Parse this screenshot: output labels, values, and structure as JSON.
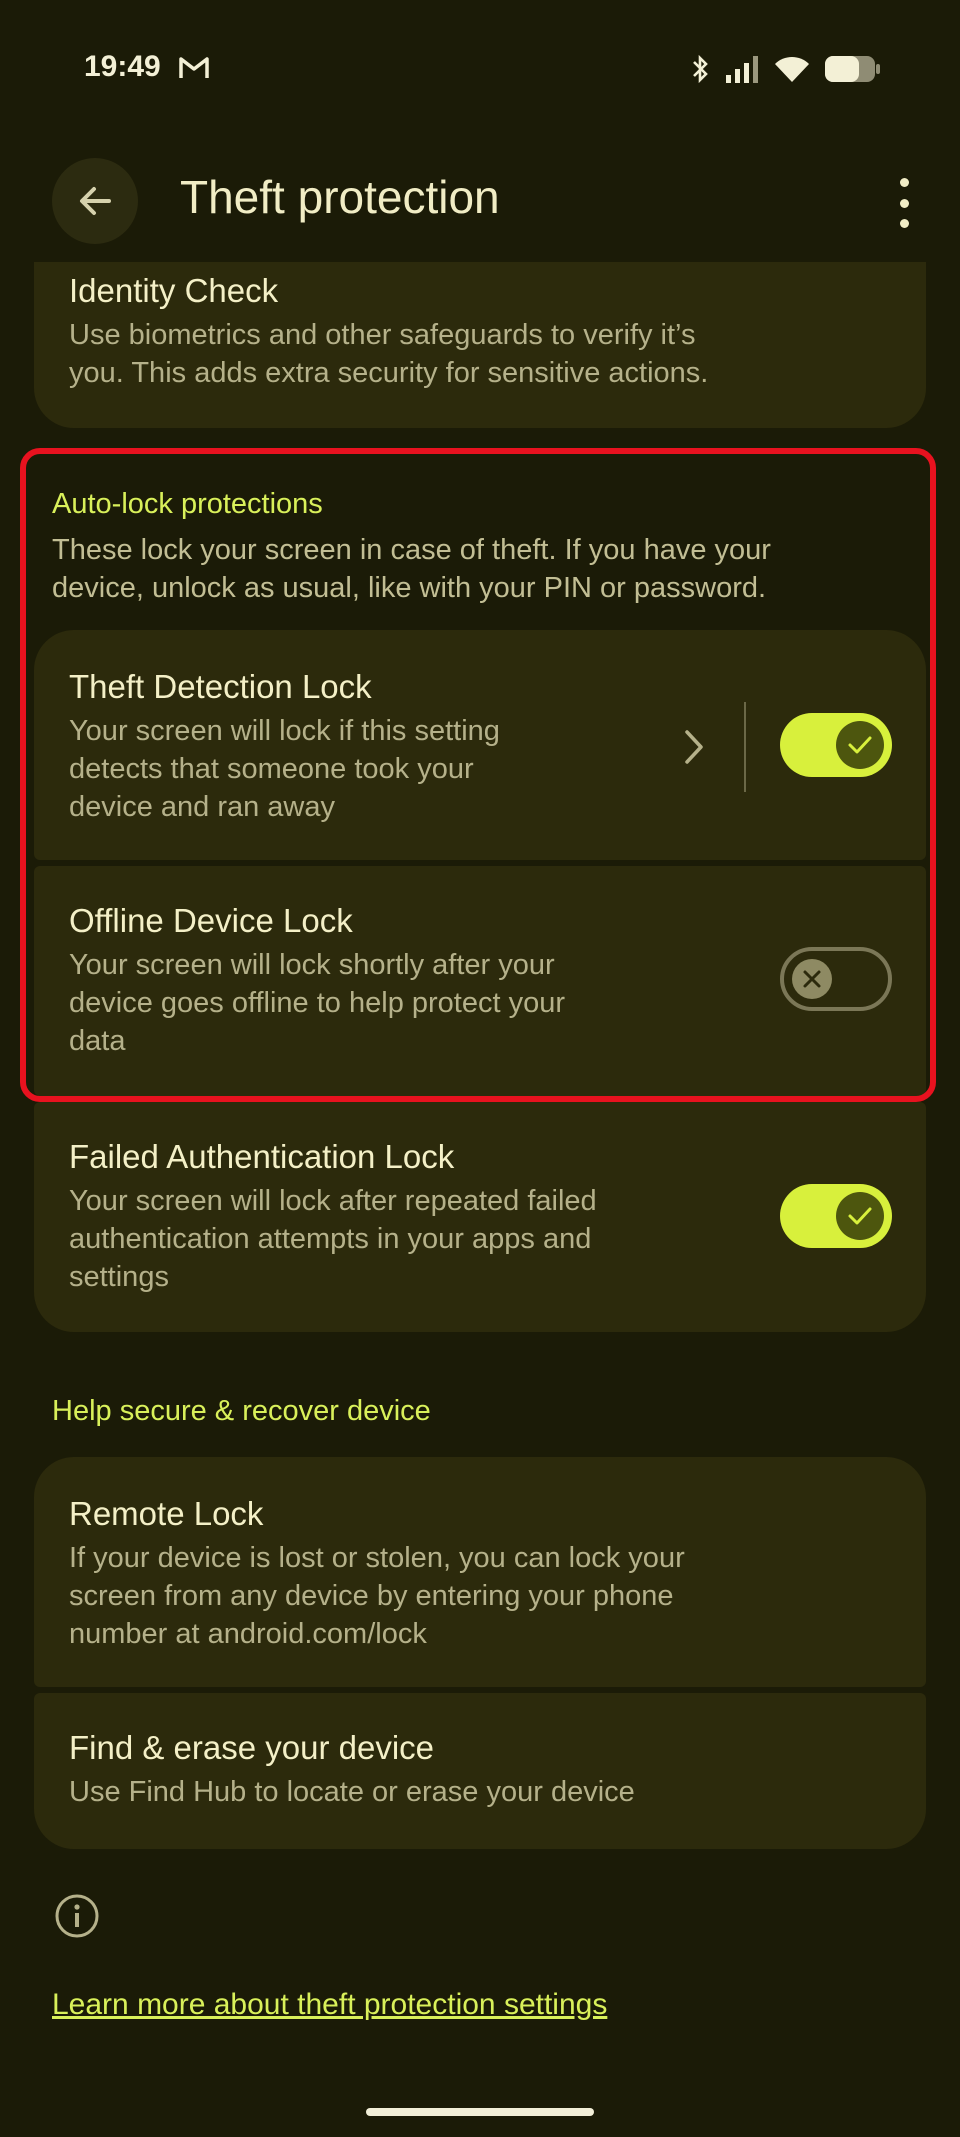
{
  "status_bar": {
    "time": "19:49"
  },
  "app_bar": {
    "title": "Theft protection"
  },
  "identity_check": {
    "title": "Identity Check",
    "desc_line1": "Use biometrics and other safeguards to verify it’s",
    "desc_line2": "you. This adds extra security for sensitive actions."
  },
  "auto_lock": {
    "section_title": "Auto-lock protections",
    "desc_line1": "These lock your screen in case of theft. If you have your",
    "desc_line2": "device, unlock as usual, like with your PIN or password.",
    "items": [
      {
        "title": "Theft Detection Lock",
        "lines": [
          "Your screen will lock if this setting",
          "detects that someone took your",
          "device and ran away"
        ],
        "enabled": true
      },
      {
        "title": "Offline Device Lock",
        "lines": [
          "Your screen will lock shortly after your",
          "device goes offline to help protect your",
          "data"
        ],
        "enabled": false
      },
      {
        "title": "Failed Authentication Lock",
        "lines": [
          "Your screen will lock after repeated failed",
          "authentication attempts in your apps and",
          "settings"
        ],
        "enabled": true
      }
    ]
  },
  "recover": {
    "section_title": "Help secure & recover device",
    "items": [
      {
        "title": "Remote Lock",
        "lines": [
          "If your device is lost or stolen, you can lock your",
          "screen from any device by entering your phone",
          "number at android.com/lock"
        ]
      },
      {
        "title": "Find & erase your device",
        "lines": [
          "Use Find Hub to locate or erase your device"
        ]
      }
    ]
  },
  "footer": {
    "learn_more": "Learn more about theft protection settings"
  },
  "colors": {
    "background": "#1b1b07",
    "card": "#2c2a0c",
    "accent": "#d8f03c",
    "highlight": "#e8121f"
  },
  "icons": [
    "gmail-icon",
    "bluetooth-icon",
    "signal-icon",
    "wifi-icon",
    "battery-icon",
    "back-arrow-icon",
    "more-vert-icon",
    "chevron-right-icon",
    "check-icon",
    "close-icon",
    "info-icon"
  ]
}
